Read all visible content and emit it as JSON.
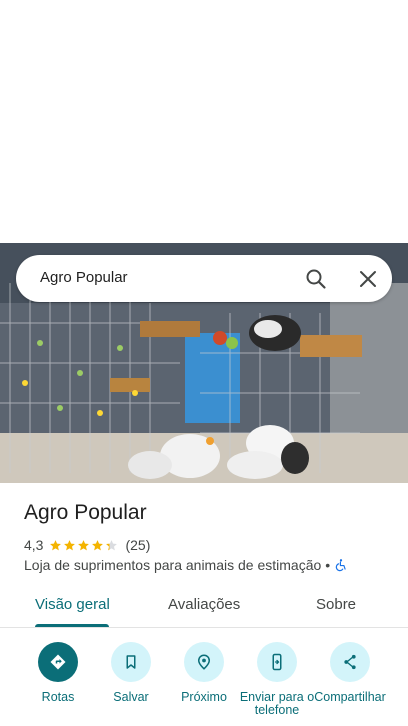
{
  "search": {
    "query": "Agro Popular"
  },
  "place": {
    "name": "Agro Popular",
    "rating": "4,3",
    "stars_value": 4.3,
    "review_count": "(25)",
    "category": "Loja de suprimentos para animais de estimação",
    "separator": "•"
  },
  "tabs": [
    {
      "label": "Visão geral",
      "active": true
    },
    {
      "label": "Avaliações",
      "active": false
    },
    {
      "label": "Sobre",
      "active": false
    }
  ],
  "actions": [
    {
      "label": "Rotas",
      "icon": "directions-icon"
    },
    {
      "label": "Salvar",
      "icon": "bookmark-icon"
    },
    {
      "label": "Próximo",
      "icon": "nearby-icon"
    },
    {
      "label": "Enviar para o telefone",
      "icon": "send-to-phone-icon"
    },
    {
      "label": "Compartilhar",
      "icon": "share-icon"
    }
  ],
  "colors": {
    "accent": "#0b6e78",
    "accent_light": "#d3f4fa",
    "star": "#f4b400",
    "accessible": "#1a73e8"
  }
}
